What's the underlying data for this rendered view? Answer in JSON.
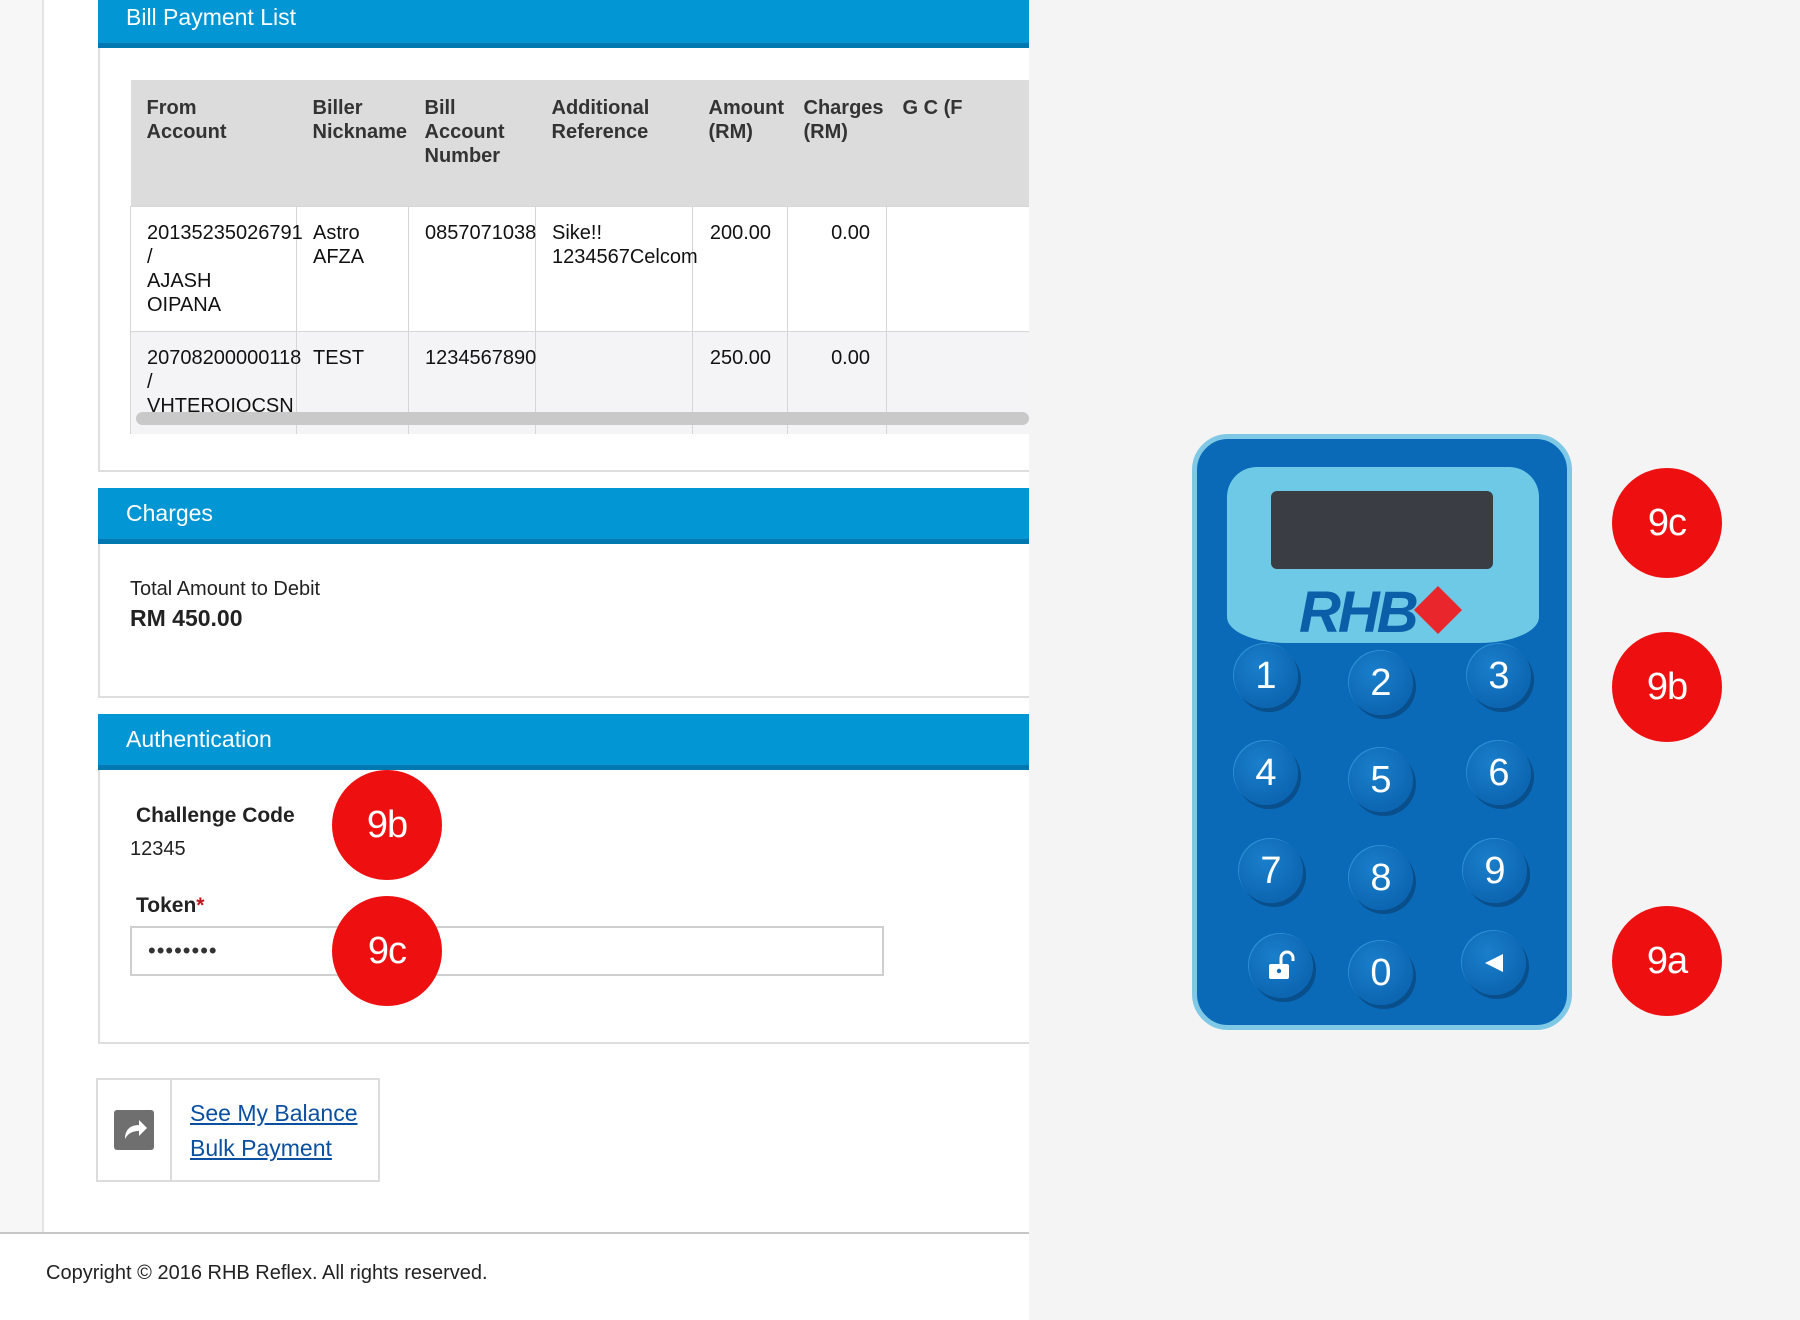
{
  "bill_list": {
    "title": "Bill Payment List",
    "columns": [
      "From Account",
      "Biller Nickname",
      "Bill Account Number",
      "Additional Reference",
      "Amount (RM)",
      "Charges (RM)",
      "G C (F"
    ],
    "rows": [
      {
        "from_account_number": "20135235026791",
        "from_account_sep": "/",
        "from_account_name": "AJASH OIPANA",
        "biller": "Astro AFZA",
        "bill_account": "0857071038",
        "reference": "Sike!! 1234567Celcom",
        "amount": "200.00",
        "charges": "0.00"
      },
      {
        "from_account_number": "20708200000118",
        "from_account_sep": "/",
        "from_account_name": "VHTEROIOCSN",
        "biller": "TEST",
        "bill_account": "1234567890",
        "reference": "",
        "amount": "250.00",
        "charges": "0.00"
      }
    ]
  },
  "charges": {
    "title": "Charges",
    "total_label": "Total Amount to Debit",
    "total_value": "RM 450.00"
  },
  "authentication": {
    "title": "Authentication",
    "challenge_label": "Challenge Code",
    "challenge_value": "12345",
    "token_label": "Token",
    "token_required_mark": "*",
    "token_value": "••••••••"
  },
  "links": {
    "see_balance": "See My Balance",
    "bulk_payment": "Bulk Payment"
  },
  "footer": {
    "copyright": "Copyright © 2016 RHB Reflex. All rights reserved."
  },
  "badges": {
    "challenge": "9b",
    "token": "9c",
    "device_screen": "9c",
    "device_keys": "9b",
    "device_unlock": "9a"
  },
  "device": {
    "logo": "RHB",
    "keys": [
      "1",
      "2",
      "3",
      "4",
      "5",
      "6",
      "7",
      "8",
      "9",
      "unlock-icon",
      "0",
      "back-arrow-icon"
    ],
    "accent_color": "#e8262b",
    "body_color": "#0b6ab8"
  },
  "colors": {
    "header_blue": "#0296d4",
    "badge_red": "#ee1011",
    "link_blue": "#0b4fa0"
  }
}
